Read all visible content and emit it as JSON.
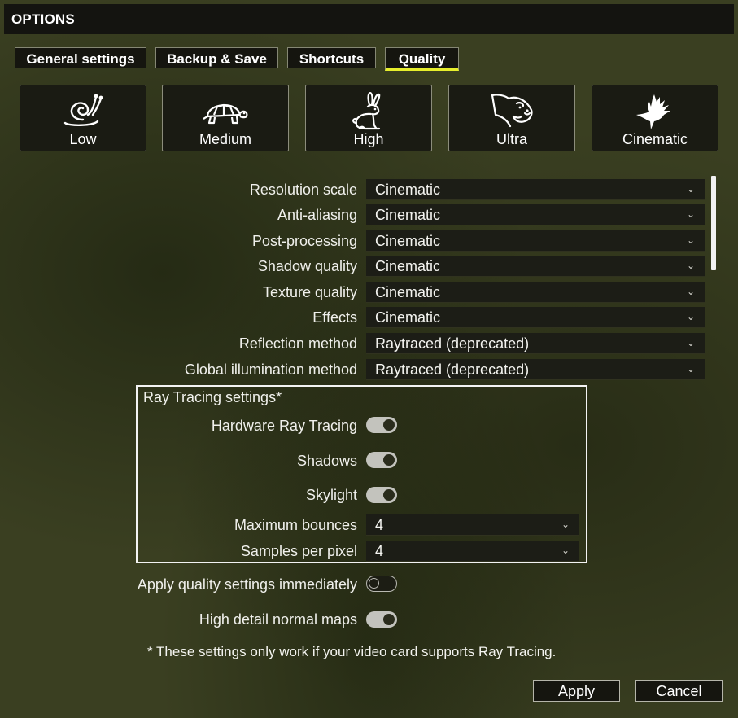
{
  "window": {
    "title": "OPTIONS"
  },
  "tabs": [
    {
      "label": "General settings",
      "active": false
    },
    {
      "label": "Backup & Save",
      "active": false
    },
    {
      "label": "Shortcuts",
      "active": false
    },
    {
      "label": "Quality",
      "active": true
    }
  ],
  "presets": [
    {
      "label": "Low",
      "icon": "snail-icon"
    },
    {
      "label": "Medium",
      "icon": "turtle-icon"
    },
    {
      "label": "High",
      "icon": "rabbit-icon"
    },
    {
      "label": "Ultra",
      "icon": "cheetah-icon"
    },
    {
      "label": "Cinematic",
      "icon": "hummingbird-icon"
    }
  ],
  "settings": [
    {
      "label": "Resolution scale",
      "value": "Cinematic"
    },
    {
      "label": "Anti-aliasing",
      "value": "Cinematic"
    },
    {
      "label": "Post-processing",
      "value": "Cinematic"
    },
    {
      "label": "Shadow quality",
      "value": "Cinematic"
    },
    {
      "label": "Texture quality",
      "value": "Cinematic"
    },
    {
      "label": "Effects",
      "value": "Cinematic"
    },
    {
      "label": "Reflection method",
      "value": "Raytraced (deprecated)"
    },
    {
      "label": "Global illumination method",
      "value": "Raytraced (deprecated)"
    }
  ],
  "raytracing": {
    "title": "Ray Tracing settings*",
    "toggles": [
      {
        "label": "Hardware Ray Tracing",
        "on": true
      },
      {
        "label": "Shadows",
        "on": true
      },
      {
        "label": "Skylight",
        "on": true
      }
    ],
    "selects": [
      {
        "label": "Maximum bounces",
        "value": "4"
      },
      {
        "label": "Samples per pixel",
        "value": "4"
      }
    ]
  },
  "extra_toggles": [
    {
      "label": "Apply quality settings immediately",
      "on": false
    },
    {
      "label": "High detail normal maps",
      "on": true
    }
  ],
  "footnote": "* These settings only work if your video card supports Ray Tracing.",
  "buttons": {
    "apply": "Apply",
    "cancel": "Cancel"
  },
  "colors": {
    "accent": "#e6ee2c",
    "background": "#3a3f21",
    "panel": "#1a1b13"
  }
}
